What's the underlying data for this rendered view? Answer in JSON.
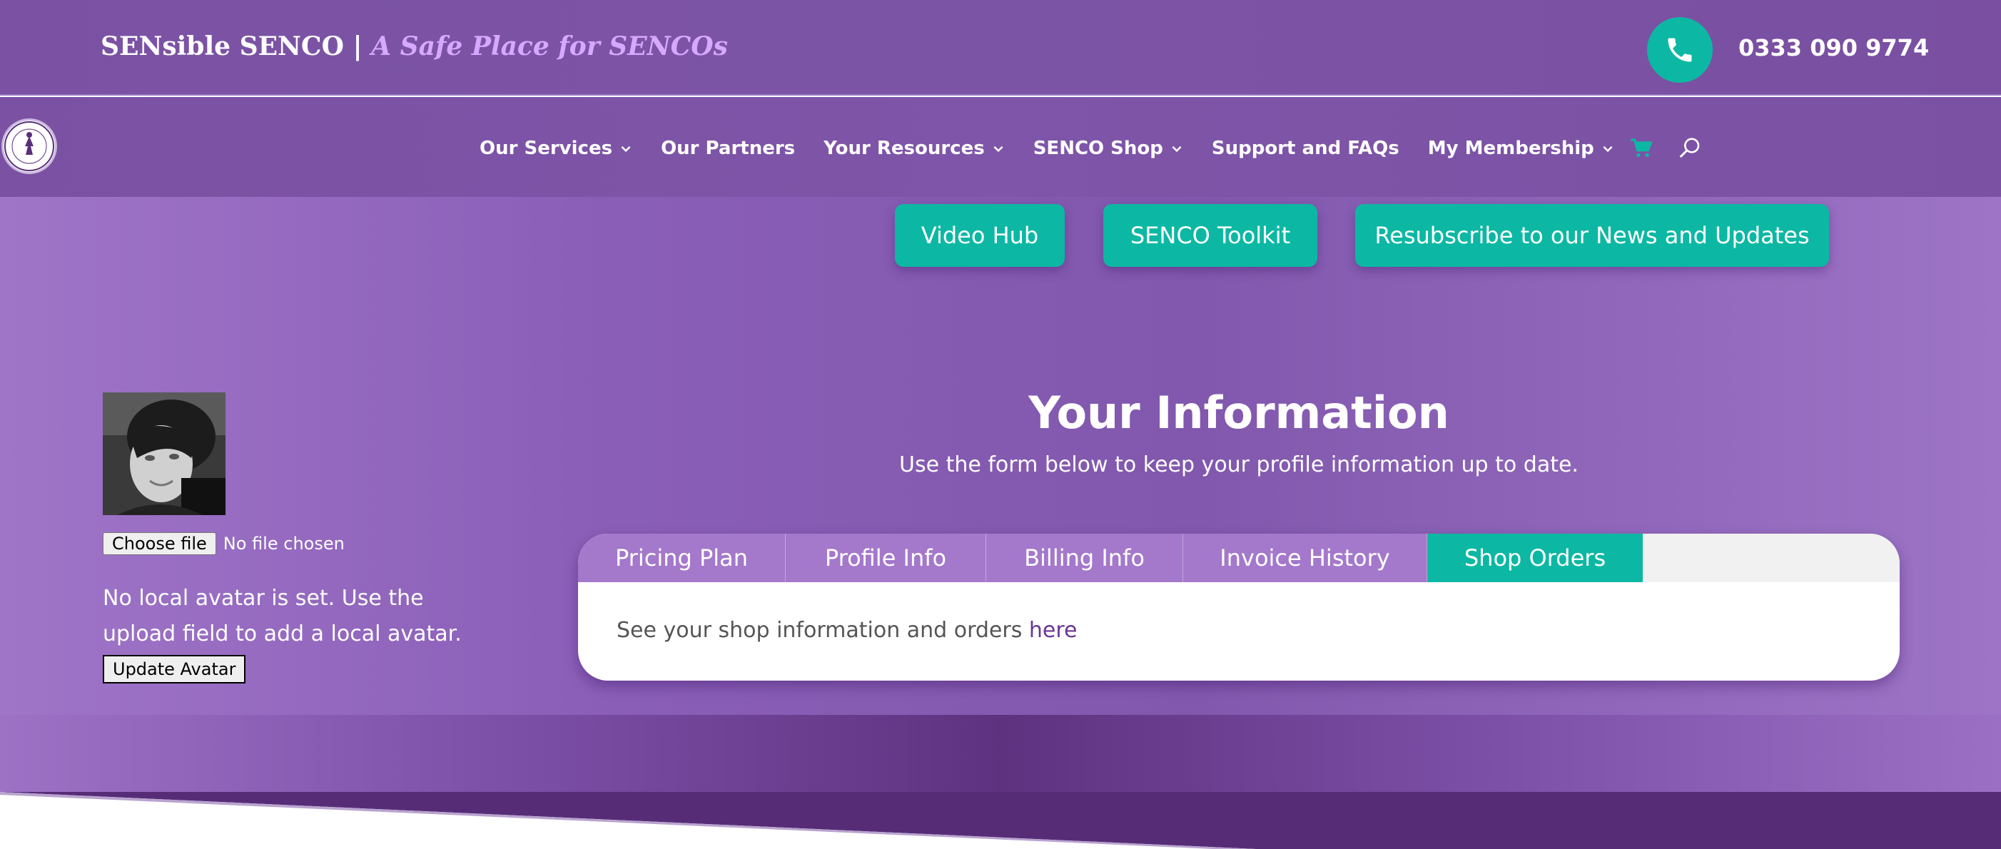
{
  "header": {
    "brand_name": "SENsible SENCO |",
    "brand_tagline": "A Safe Place for SENCOs",
    "phone": "0333 090 9774"
  },
  "nav": {
    "items": [
      {
        "label": "Our Services",
        "dropdown": true
      },
      {
        "label": "Our Partners",
        "dropdown": false
      },
      {
        "label": "Your Resources",
        "dropdown": true
      },
      {
        "label": "SENCO Shop",
        "dropdown": true
      },
      {
        "label": "Support and FAQs",
        "dropdown": false
      },
      {
        "label": "My Membership",
        "dropdown": true
      }
    ],
    "icons": [
      "cart-icon",
      "search-icon"
    ]
  },
  "quick_links": {
    "video_hub": "Video Hub",
    "senco_toolkit": "SENCO Toolkit",
    "resubscribe": "Resubscribe to our News and Updates"
  },
  "avatar": {
    "choose_file": "Choose file",
    "no_file": "No file chosen",
    "note": "No local avatar is set. Use the upload field to add a local avatar.",
    "update_button": "Update Avatar"
  },
  "profile": {
    "title": "Your Information",
    "subtitle": "Use the form below to keep your profile information up to date.",
    "tabs": [
      "Pricing Plan",
      "Profile Info",
      "Billing Info",
      "Invoice History",
      "Shop Orders"
    ],
    "active_tab": "Shop Orders",
    "body_text": "See your shop information and orders",
    "body_link": "here"
  },
  "colors": {
    "accent": "#0cb8a3",
    "purple": "#7c54a6",
    "tagline": "#d7a8ff",
    "tab": "#a478cb"
  }
}
